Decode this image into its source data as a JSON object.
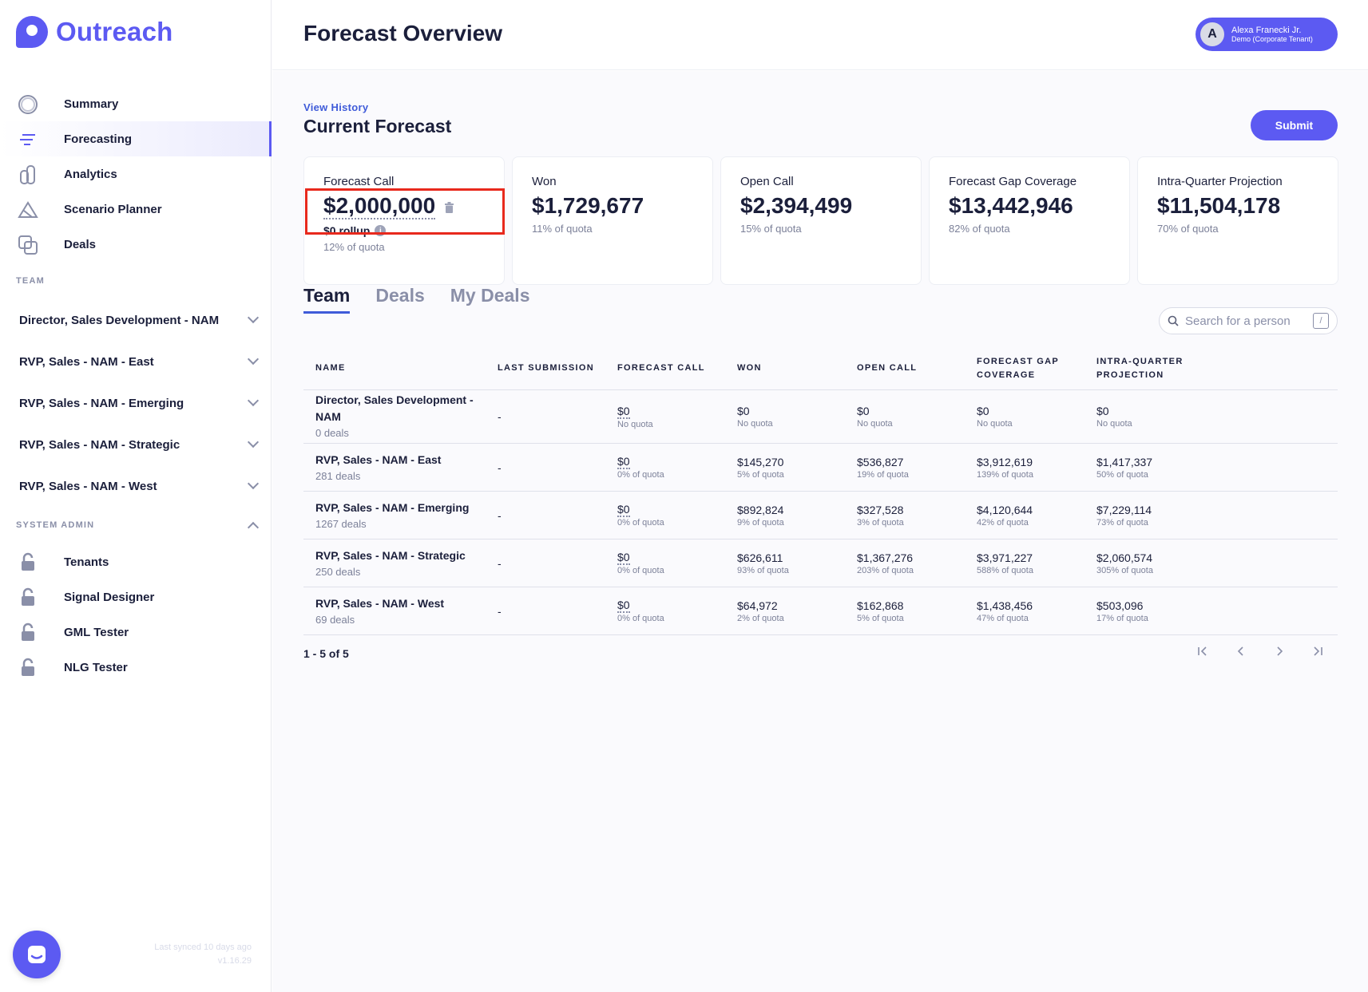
{
  "app": {
    "name": "Outreach"
  },
  "nav": {
    "items": [
      {
        "label": "Summary",
        "icon": "summary-circle-icon"
      },
      {
        "label": "Forecasting",
        "icon": "forecasting-lines-icon",
        "active": true
      },
      {
        "label": "Analytics",
        "icon": "analytics-icon"
      },
      {
        "label": "Scenario Planner",
        "icon": "scenario-planner-icon"
      },
      {
        "label": "Deals",
        "icon": "deals-icon"
      }
    ]
  },
  "team_section": {
    "label": "TEAM",
    "items": [
      {
        "label": "Director, Sales Development - NAM"
      },
      {
        "label": "RVP, Sales - NAM - East"
      },
      {
        "label": "RVP, Sales - NAM - Emerging"
      },
      {
        "label": "RVP, Sales - NAM - Strategic"
      },
      {
        "label": "RVP, Sales - NAM - West"
      }
    ]
  },
  "admin_section": {
    "label": "SYSTEM ADMIN",
    "items": [
      {
        "label": "Tenants",
        "icon": "unlock-icon"
      },
      {
        "label": "Signal Designer",
        "icon": "unlock-icon"
      },
      {
        "label": "GML Tester",
        "icon": "unlock-icon"
      },
      {
        "label": "NLG Tester",
        "icon": "unlock-icon"
      }
    ]
  },
  "sync": {
    "last_synced": "Last synced 10 days ago",
    "version": "v1.16.29"
  },
  "header": {
    "title": "Forecast Overview",
    "user": {
      "initial": "A",
      "name": "Alexa Franecki Jr.",
      "tenant": "Demo (Corporate Tenant)"
    }
  },
  "forecast": {
    "view_history": "View History",
    "title": "Current Forecast",
    "submit_label": "Submit",
    "cards": {
      "forecast_call": {
        "title": "Forecast Call",
        "value": "$2,000,000",
        "rollup": "$0 rollup",
        "sub": "12% of quota"
      },
      "won": {
        "title": "Won",
        "value": "$1,729,677",
        "sub": "11% of quota"
      },
      "open_call": {
        "title": "Open Call",
        "value": "$2,394,499",
        "sub": "15% of quota"
      },
      "gap_coverage": {
        "title": "Forecast Gap Coverage",
        "value": "$13,442,946",
        "sub": "82% of quota"
      },
      "projection": {
        "title": "Intra-Quarter Projection",
        "value": "$11,504,178",
        "sub": "70% of quota"
      }
    }
  },
  "tabs": [
    {
      "label": "Team",
      "active": true
    },
    {
      "label": "Deals"
    },
    {
      "label": "My Deals"
    }
  ],
  "search": {
    "placeholder": "Search for a person",
    "shortcut": "/"
  },
  "table": {
    "headers": {
      "name": "NAME",
      "last_submission": "LAST SUBMISSION",
      "forecast_call": "FORECAST CALL",
      "won": "WON",
      "open_call": "OPEN CALL",
      "gap_coverage": "FORECAST GAP COVERAGE",
      "projection": "INTRA-QUARTER PROJECTION"
    },
    "rows": [
      {
        "name": "Director, Sales Development - NAM",
        "deals": "0 deals",
        "last": "-",
        "fc": "$0",
        "fc_sub": "No quota",
        "won": "$0",
        "won_sub": "No quota",
        "open": "$0",
        "open_sub": "No quota",
        "gap": "$0",
        "gap_sub": "No quota",
        "proj": "$0",
        "proj_sub": "No quota"
      },
      {
        "name": "RVP, Sales - NAM - East",
        "deals": "281 deals",
        "last": "-",
        "fc": "$0",
        "fc_sub": "0% of quota",
        "won": "$145,270",
        "won_sub": "5% of quota",
        "open": "$536,827",
        "open_sub": "19% of quota",
        "gap": "$3,912,619",
        "gap_sub": "139% of quota",
        "proj": "$1,417,337",
        "proj_sub": "50% of quota"
      },
      {
        "name": "RVP, Sales - NAM - Emerging",
        "deals": "1267 deals",
        "last": "-",
        "fc": "$0",
        "fc_sub": "0% of quota",
        "won": "$892,824",
        "won_sub": "9% of quota",
        "open": "$327,528",
        "open_sub": "3% of quota",
        "gap": "$4,120,644",
        "gap_sub": "42% of quota",
        "proj": "$7,229,114",
        "proj_sub": "73% of quota"
      },
      {
        "name": "RVP, Sales - NAM - Strategic",
        "deals": "250 deals",
        "last": "-",
        "fc": "$0",
        "fc_sub": "0% of quota",
        "won": "$626,611",
        "won_sub": "93% of quota",
        "open": "$1,367,276",
        "open_sub": "203% of quota",
        "gap": "$3,971,227",
        "gap_sub": "588% of quota",
        "proj": "$2,060,574",
        "proj_sub": "305% of quota"
      },
      {
        "name": "RVP, Sales - NAM - West",
        "deals": "69 deals",
        "last": "-",
        "fc": "$0",
        "fc_sub": "0% of quota",
        "won": "$64,972",
        "won_sub": "2% of quota",
        "open": "$162,868",
        "open_sub": "5% of quota",
        "gap": "$1,438,456",
        "gap_sub": "47% of quota",
        "proj": "$503,096",
        "proj_sub": "17% of quota"
      }
    ]
  },
  "pagination": {
    "summary": "1 - 5 of 5"
  },
  "colors": {
    "brand": "#5c5af2",
    "link": "#3f5bd9",
    "highlight": "#e8291d"
  }
}
